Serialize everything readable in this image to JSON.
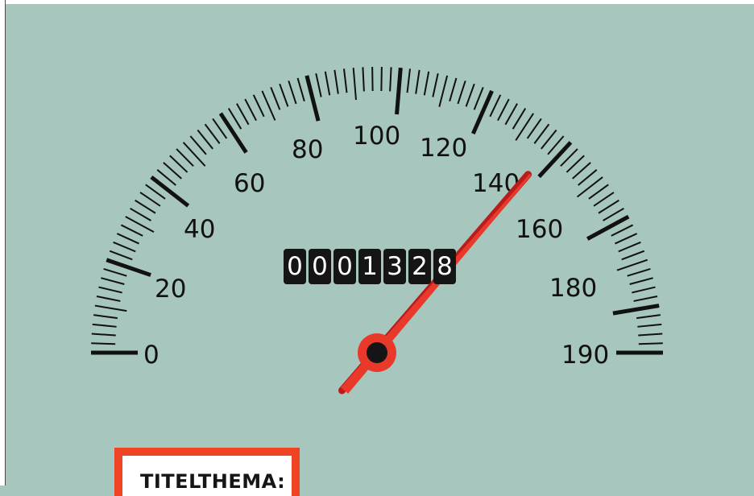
{
  "gauge": {
    "min": 0,
    "max": 190,
    "major_labels": [
      "0",
      "20",
      "40",
      "60",
      "80",
      "100",
      "120",
      "140",
      "160",
      "180",
      "190"
    ],
    "needle_value": 138,
    "colors": {
      "background": "#a7c6bd",
      "needle": "#e8392a",
      "needle_shadow": "#b81c1c",
      "ticks": "#111111",
      "hub": "#151515"
    }
  },
  "odometer": {
    "digits": [
      "0",
      "0",
      "0",
      "1",
      "3",
      "2",
      "8"
    ]
  },
  "titel": {
    "label": "TITELTHEMA:",
    "accent_color": "#ee4423"
  }
}
